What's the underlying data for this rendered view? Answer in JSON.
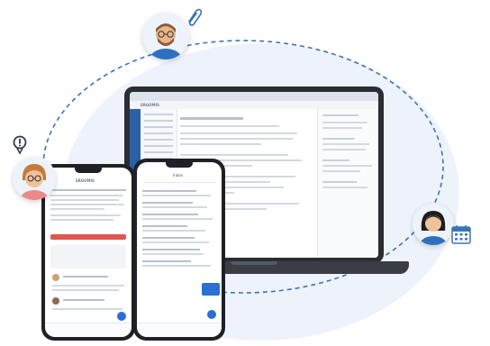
{
  "header": {
    "brand": "ERGOMIS"
  },
  "phone_left": {
    "brand": "ERGOMIS"
  },
  "phone_right": {
    "title": "Inbox"
  },
  "people": [
    {
      "name": "man-with-glasses",
      "badge": "paperclip-icon"
    },
    {
      "name": "woman-with-glasses",
      "badge": "exclamation-icon"
    },
    {
      "name": "woman-dark-hair",
      "badge": "calendar-icon"
    }
  ],
  "colors": {
    "dash": "#3c73b8",
    "blob": "#eef3fb",
    "accent": "#2a6fd6",
    "alert": "#e05555"
  }
}
